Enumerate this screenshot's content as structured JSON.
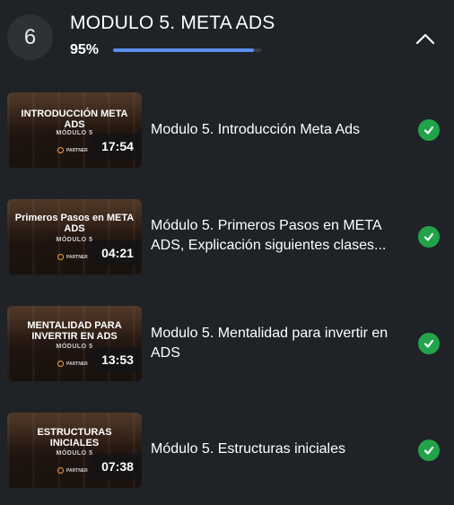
{
  "module": {
    "number": "6",
    "title": "MODULO 5. META ADS",
    "progress_label": "95%",
    "progress_value": 0.95
  },
  "colors": {
    "background": "#1f2226",
    "progress_fill": "#5b8ef0",
    "complete_check": "#22a34b"
  },
  "lessons": [
    {
      "title": "Modulo 5. Introducción Meta Ads",
      "thumb_title": "INTRODUCCIÓN META ADS",
      "thumb_subtitle": "MÓDULO 5",
      "thumb_logo": "PARTNER",
      "duration": "17:54",
      "completed": true
    },
    {
      "title": "Módulo 5. Primeros Pasos en META ADS, Explicación siguientes clases...",
      "thumb_title": "Primeros Pasos en META ADS",
      "thumb_subtitle": "MÓDULO 5",
      "thumb_logo": "PARTNER",
      "duration": "04:21",
      "completed": true
    },
    {
      "title": "Modulo 5. Mentalidad para invertir en ADS",
      "thumb_title": "MENTALIDAD PARA INVERTIR EN ADS",
      "thumb_subtitle": "MÓDULO 5",
      "thumb_logo": "PARTNER",
      "duration": "13:53",
      "completed": true
    },
    {
      "title": "Módulo 5. Estructuras iniciales",
      "thumb_title": "ESTRUCTURAS INICIALES",
      "thumb_subtitle": "MÓDULO 5",
      "thumb_logo": "PARTNER",
      "duration": "07:38",
      "completed": true
    }
  ],
  "icons": {
    "collapse": "chevron-up-icon",
    "completed": "check-circle-icon",
    "logo": "partner-logo-icon"
  }
}
